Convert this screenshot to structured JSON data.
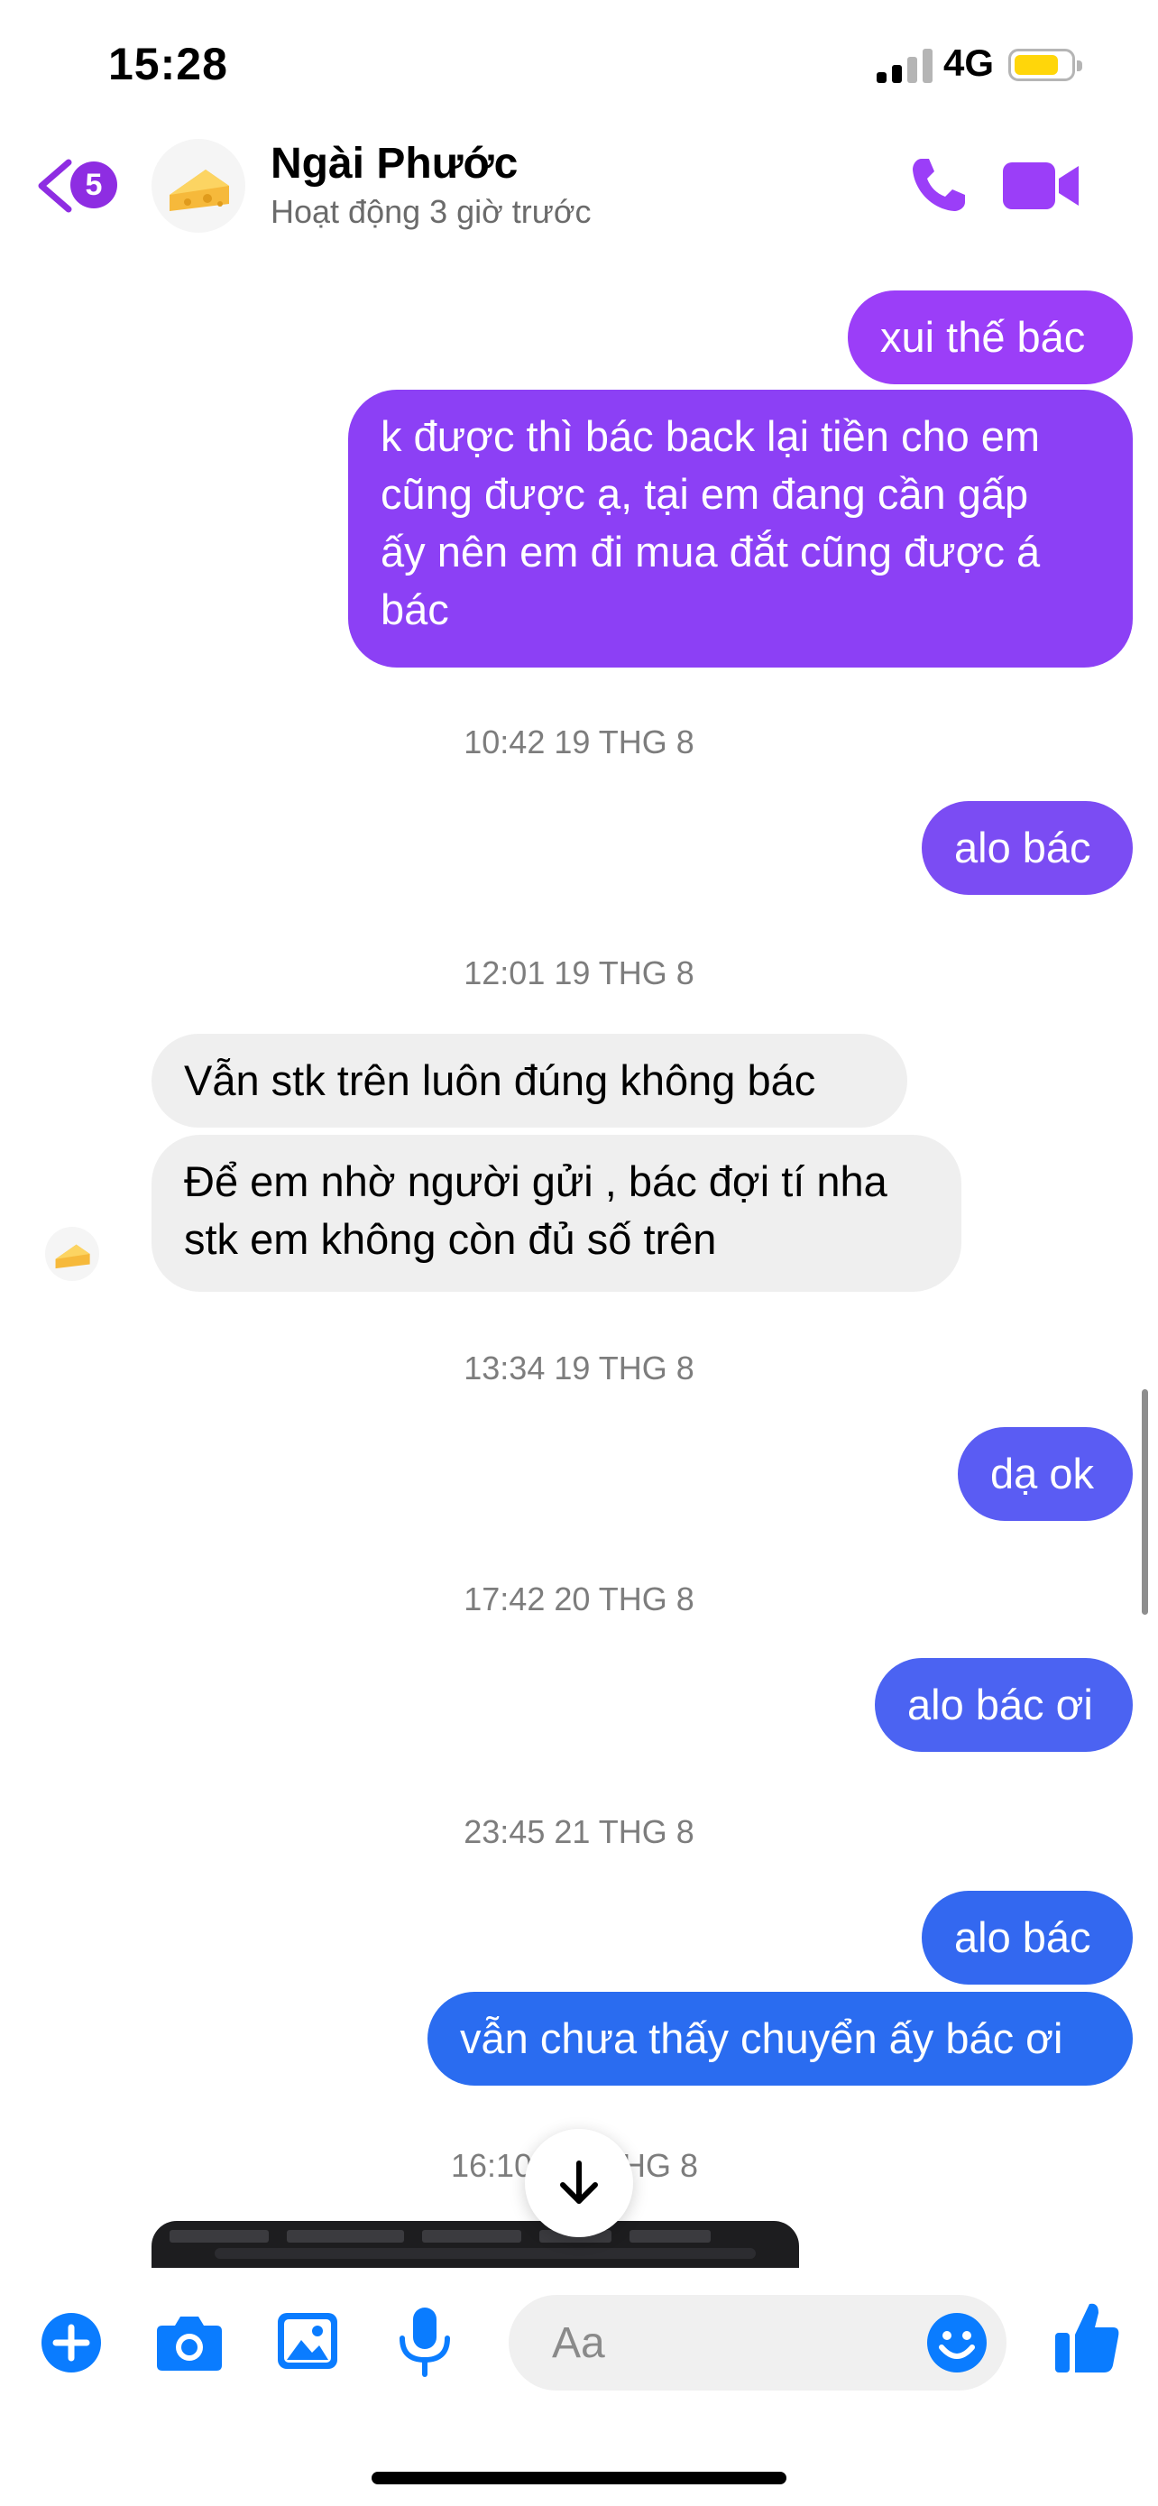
{
  "status_bar": {
    "time": "15:28",
    "network": "4G",
    "battery_level": 0.8
  },
  "header": {
    "back_badge": "5",
    "contact_name": "Ngài Phước",
    "contact_status": "Hoạt động 3 giờ trước",
    "accent_color": "#a033ff"
  },
  "messages": [
    {
      "text": "xui thế bác",
      "direction": "out",
      "color": "#9b3ef8"
    },
    {
      "text": "k được thì bác back lại tiền cho em\ncũng được ạ, tại em đang cần gấp\nấy nên em đi mua đắt cũng được á\nbác",
      "direction": "out",
      "color": "#8c40f5"
    },
    {
      "text": "alo bác",
      "direction": "out",
      "color": "#7b4cf3"
    },
    {
      "text": "Vẫn stk trên luôn đúng không bác",
      "direction": "in"
    },
    {
      "text": "Để em nhờ người gửi , bác đợi tí nha\nstk em không còn đủ số trên",
      "direction": "in"
    },
    {
      "text": "dạ ok",
      "direction": "out",
      "color": "#5a5cf3"
    },
    {
      "text": "alo bác ơi",
      "direction": "out",
      "color": "#4b63f2"
    },
    {
      "text": "alo bác",
      "direction": "out",
      "color": "#3368f0"
    },
    {
      "text": "vẫn chưa thấy chuyển ấy bác ơi",
      "direction": "out",
      "color": "#2a6cf0"
    }
  ],
  "timestamps": [
    "10:42 19 THG 8",
    "12:01 19 THG 8",
    "13:34 19 THG 8",
    "17:42 20 THG 8",
    "23:45 21 THG 8",
    "16:10",
    "HG 8"
  ],
  "composer": {
    "placeholder": "Aa",
    "icons": [
      "add-icon",
      "camera-icon",
      "image-icon",
      "microphone-icon",
      "emoji-icon",
      "like-icon"
    ],
    "icon_color": "#0a7cff"
  }
}
